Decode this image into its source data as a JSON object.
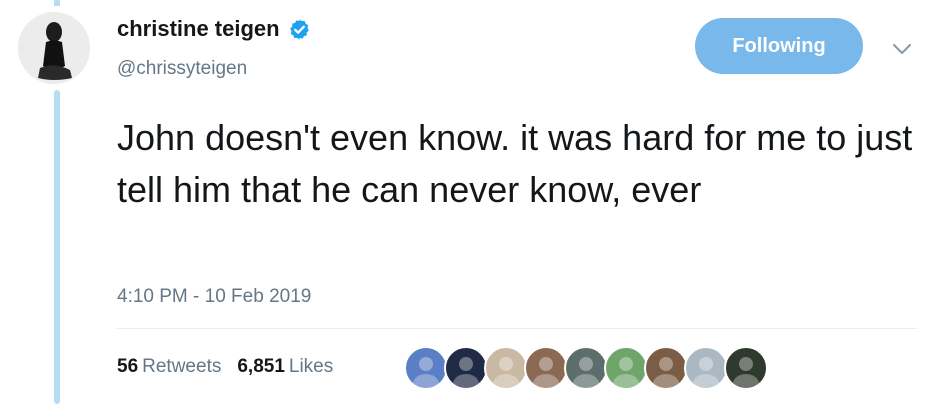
{
  "user": {
    "display_name": "christine teigen",
    "handle": "@chrissyteigen",
    "verified": true,
    "avatar_icon": "profile-photo-icon"
  },
  "actions": {
    "follow_label": "Following",
    "more_icon": "chevron-down-icon"
  },
  "tweet": {
    "text": "John doesn't even know. it was hard for me to just tell him that he can never know, ever",
    "timestamp": "4:10 PM - 10 Feb 2019"
  },
  "stats": {
    "retweets_count": "56",
    "retweets_label": "Retweets",
    "likes_count": "6,851",
    "likes_label": "Likes"
  },
  "likers": [
    {
      "icon": "liker-avatar-icon",
      "color": "#5b7fc4"
    },
    {
      "icon": "liker-avatar-icon",
      "color": "#1f2a44"
    },
    {
      "icon": "liker-avatar-icon",
      "color": "#c9b9a3"
    },
    {
      "icon": "liker-avatar-icon",
      "color": "#8a6a55"
    },
    {
      "icon": "liker-avatar-icon",
      "color": "#5c6e6a"
    },
    {
      "icon": "liker-avatar-icon",
      "color": "#6fa56a"
    },
    {
      "icon": "liker-avatar-icon",
      "color": "#7b5d45"
    },
    {
      "icon": "liker-avatar-icon",
      "color": "#aab8c2"
    },
    {
      "icon": "liker-avatar-icon",
      "color": "#2f3a2e"
    }
  ],
  "colors": {
    "accent": "#78b8ea",
    "verified": "#1da1f2",
    "thread_line": "#b8ddf3",
    "secondary_text": "#657786"
  }
}
